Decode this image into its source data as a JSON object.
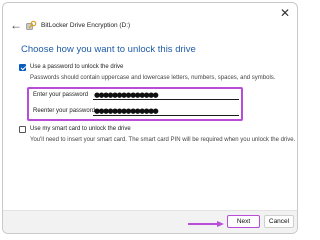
{
  "window": {
    "title": "BitLocker Drive Encryption (D:)"
  },
  "heading": "Choose how you want to unlock this drive",
  "password_option": {
    "label": "Use a password to unlock the drive",
    "checked": true,
    "description": "Passwords should contain uppercase and lowercase letters, numbers, spaces, and symbols.",
    "enter_label": "Enter your password",
    "enter_value": "●●●●●●●●●●●●●●",
    "reenter_label": "Reenter your password",
    "reenter_value": "●●●●●●●●●●●●●●"
  },
  "smartcard_option": {
    "label": "Use my smart card to unlock the drive",
    "checked": false,
    "description": "You'll need to insert your smart card. The smart card PIN will be required when you unlock the drive."
  },
  "buttons": {
    "next": "Next",
    "cancel": "Cancel"
  },
  "colors": {
    "highlight": "#b74dd9",
    "heading": "#1f5ca8",
    "checkbox": "#0b5cbf"
  },
  "icons": [
    "close-icon",
    "back-arrow-icon",
    "bitlocker-key-icon",
    "pointer-arrow-icon"
  ]
}
